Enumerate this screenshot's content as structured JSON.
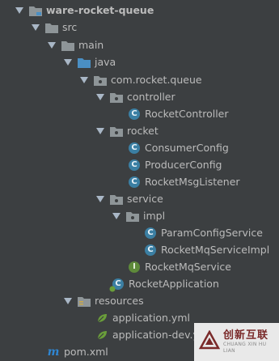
{
  "tree": {
    "project": "ware-rocket-queue",
    "src": "src",
    "main": "main",
    "java": "java",
    "package": "com.rocket.queue",
    "controller": "controller",
    "rocket_controller": "RocketController",
    "rocket_pkg": "rocket",
    "consumer_config": "ConsumerConfig",
    "producer_config": "ProducerConfig",
    "rocket_msg_listener": "RocketMsgListener",
    "service": "service",
    "impl": "impl",
    "param_config_service": "ParamConfigService",
    "rocket_mq_service_impl": "RocketMqServiceImpl",
    "rocket_mq_service": "RocketMqService",
    "rocket_application": "RocketApplication",
    "resources": "resources",
    "application_yml": "application.yml",
    "application_dev_yml": "application-dev.yml",
    "pom_xml": "pom.xml"
  },
  "badges": {
    "class_letter": "C",
    "interface_letter": "I",
    "maven_letter": "m"
  },
  "watermark": {
    "cn": "创新互联",
    "en": "CHUANG XIN HU LIAN"
  },
  "colors": {
    "background": "#3c3f41",
    "text": "#bbbbbb",
    "folder": "#8e9598",
    "source_folder": "#4a8fc4",
    "class_badge": "#3b7fa3",
    "interface_badge": "#5e8a3a",
    "maven": "#2f86d2"
  }
}
